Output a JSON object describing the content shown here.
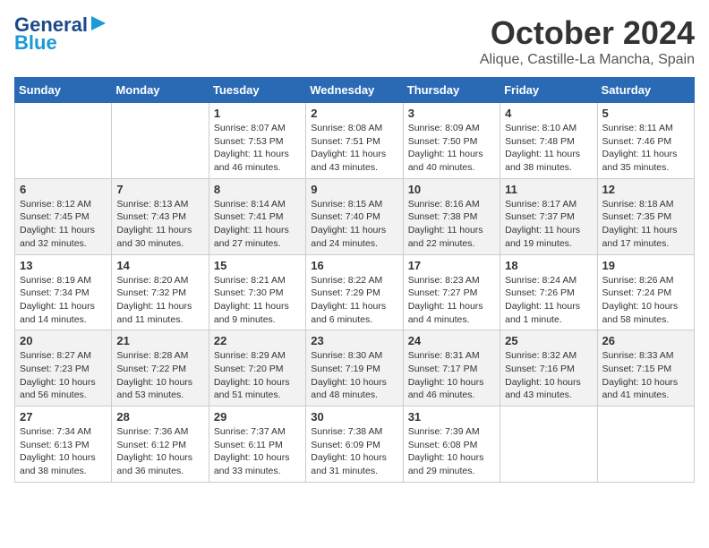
{
  "header": {
    "logo_line1": "General",
    "logo_line2": "Blue",
    "month": "October 2024",
    "location": "Alique, Castille-La Mancha, Spain"
  },
  "days_of_week": [
    "Sunday",
    "Monday",
    "Tuesday",
    "Wednesday",
    "Thursday",
    "Friday",
    "Saturday"
  ],
  "weeks": [
    [
      {
        "day": "",
        "info": ""
      },
      {
        "day": "",
        "info": ""
      },
      {
        "day": "1",
        "info": "Sunrise: 8:07 AM\nSunset: 7:53 PM\nDaylight: 11 hours and 46 minutes."
      },
      {
        "day": "2",
        "info": "Sunrise: 8:08 AM\nSunset: 7:51 PM\nDaylight: 11 hours and 43 minutes."
      },
      {
        "day": "3",
        "info": "Sunrise: 8:09 AM\nSunset: 7:50 PM\nDaylight: 11 hours and 40 minutes."
      },
      {
        "day": "4",
        "info": "Sunrise: 8:10 AM\nSunset: 7:48 PM\nDaylight: 11 hours and 38 minutes."
      },
      {
        "day": "5",
        "info": "Sunrise: 8:11 AM\nSunset: 7:46 PM\nDaylight: 11 hours and 35 minutes."
      }
    ],
    [
      {
        "day": "6",
        "info": "Sunrise: 8:12 AM\nSunset: 7:45 PM\nDaylight: 11 hours and 32 minutes."
      },
      {
        "day": "7",
        "info": "Sunrise: 8:13 AM\nSunset: 7:43 PM\nDaylight: 11 hours and 30 minutes."
      },
      {
        "day": "8",
        "info": "Sunrise: 8:14 AM\nSunset: 7:41 PM\nDaylight: 11 hours and 27 minutes."
      },
      {
        "day": "9",
        "info": "Sunrise: 8:15 AM\nSunset: 7:40 PM\nDaylight: 11 hours and 24 minutes."
      },
      {
        "day": "10",
        "info": "Sunrise: 8:16 AM\nSunset: 7:38 PM\nDaylight: 11 hours and 22 minutes."
      },
      {
        "day": "11",
        "info": "Sunrise: 8:17 AM\nSunset: 7:37 PM\nDaylight: 11 hours and 19 minutes."
      },
      {
        "day": "12",
        "info": "Sunrise: 8:18 AM\nSunset: 7:35 PM\nDaylight: 11 hours and 17 minutes."
      }
    ],
    [
      {
        "day": "13",
        "info": "Sunrise: 8:19 AM\nSunset: 7:34 PM\nDaylight: 11 hours and 14 minutes."
      },
      {
        "day": "14",
        "info": "Sunrise: 8:20 AM\nSunset: 7:32 PM\nDaylight: 11 hours and 11 minutes."
      },
      {
        "day": "15",
        "info": "Sunrise: 8:21 AM\nSunset: 7:30 PM\nDaylight: 11 hours and 9 minutes."
      },
      {
        "day": "16",
        "info": "Sunrise: 8:22 AM\nSunset: 7:29 PM\nDaylight: 11 hours and 6 minutes."
      },
      {
        "day": "17",
        "info": "Sunrise: 8:23 AM\nSunset: 7:27 PM\nDaylight: 11 hours and 4 minutes."
      },
      {
        "day": "18",
        "info": "Sunrise: 8:24 AM\nSunset: 7:26 PM\nDaylight: 11 hours and 1 minute."
      },
      {
        "day": "19",
        "info": "Sunrise: 8:26 AM\nSunset: 7:24 PM\nDaylight: 10 hours and 58 minutes."
      }
    ],
    [
      {
        "day": "20",
        "info": "Sunrise: 8:27 AM\nSunset: 7:23 PM\nDaylight: 10 hours and 56 minutes."
      },
      {
        "day": "21",
        "info": "Sunrise: 8:28 AM\nSunset: 7:22 PM\nDaylight: 10 hours and 53 minutes."
      },
      {
        "day": "22",
        "info": "Sunrise: 8:29 AM\nSunset: 7:20 PM\nDaylight: 10 hours and 51 minutes."
      },
      {
        "day": "23",
        "info": "Sunrise: 8:30 AM\nSunset: 7:19 PM\nDaylight: 10 hours and 48 minutes."
      },
      {
        "day": "24",
        "info": "Sunrise: 8:31 AM\nSunset: 7:17 PM\nDaylight: 10 hours and 46 minutes."
      },
      {
        "day": "25",
        "info": "Sunrise: 8:32 AM\nSunset: 7:16 PM\nDaylight: 10 hours and 43 minutes."
      },
      {
        "day": "26",
        "info": "Sunrise: 8:33 AM\nSunset: 7:15 PM\nDaylight: 10 hours and 41 minutes."
      }
    ],
    [
      {
        "day": "27",
        "info": "Sunrise: 7:34 AM\nSunset: 6:13 PM\nDaylight: 10 hours and 38 minutes."
      },
      {
        "day": "28",
        "info": "Sunrise: 7:36 AM\nSunset: 6:12 PM\nDaylight: 10 hours and 36 minutes."
      },
      {
        "day": "29",
        "info": "Sunrise: 7:37 AM\nSunset: 6:11 PM\nDaylight: 10 hours and 33 minutes."
      },
      {
        "day": "30",
        "info": "Sunrise: 7:38 AM\nSunset: 6:09 PM\nDaylight: 10 hours and 31 minutes."
      },
      {
        "day": "31",
        "info": "Sunrise: 7:39 AM\nSunset: 6:08 PM\nDaylight: 10 hours and 29 minutes."
      },
      {
        "day": "",
        "info": ""
      },
      {
        "day": "",
        "info": ""
      }
    ]
  ]
}
